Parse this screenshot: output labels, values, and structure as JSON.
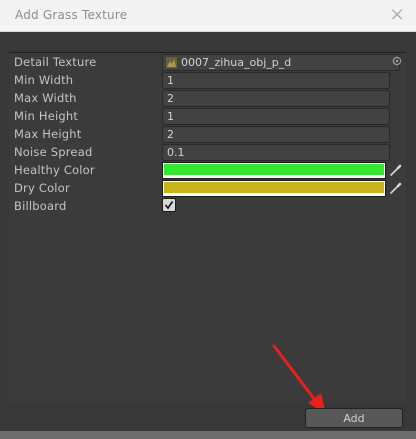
{
  "window": {
    "title": "Add Grass Texture",
    "close_glyph": "×"
  },
  "fields": [
    {
      "label": "Detail Texture",
      "value": "0007_zihua_obj_p_d",
      "type": "object"
    },
    {
      "label": "Min Width",
      "value": "1",
      "type": "number"
    },
    {
      "label": "Max Width",
      "value": "2",
      "type": "number"
    },
    {
      "label": "Min Height",
      "value": "1",
      "type": "number"
    },
    {
      "label": "Max Height",
      "value": "2",
      "type": "number"
    },
    {
      "label": "Noise Spread",
      "value": "0.1",
      "type": "number"
    },
    {
      "label": "Healthy Color",
      "color": "#33e733",
      "type": "color"
    },
    {
      "label": "Dry Color",
      "color": "#c9b41d",
      "type": "color"
    },
    {
      "label": "Billboard",
      "checked": true,
      "type": "checkbox"
    }
  ],
  "buttons": {
    "add_label": "Add"
  },
  "icons": {
    "object_picker": "circle-dot-icon",
    "eyedropper": "eyedropper-icon",
    "texture": "texture-icon",
    "close": "close-icon"
  }
}
